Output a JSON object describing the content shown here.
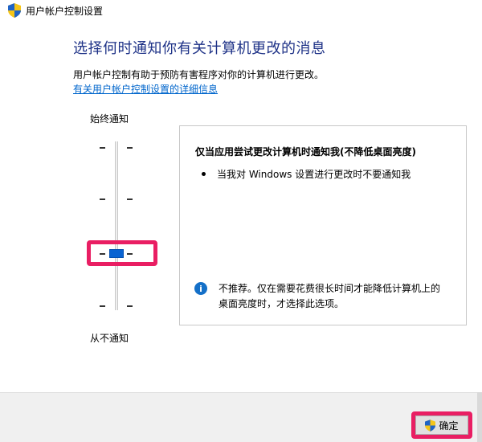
{
  "window": {
    "title": "用户帐户控制设置",
    "icon": "uac-shield-icon"
  },
  "main": {
    "heading": "选择何时通知你有关计算机更改的消息",
    "description": "用户帐户控制有助于预防有害程序对你的计算机进行更改。",
    "more_info_link": "有关用户帐户控制设置的详细信息"
  },
  "slider": {
    "top_label": "始终通知",
    "bottom_label": "从不通知",
    "levels": 4,
    "selected_level": 2,
    "thumb_color": "#0a64d2",
    "highlight_color": "#e91e63"
  },
  "info_panel": {
    "title": "仅当应用尝试更改计算机时通知我(不降低桌面亮度)",
    "bullet": "当我对 Windows 设置进行更改时不要通知我",
    "note_icon": "info-icon",
    "note_line1": "不推荐。仅在需要花费很长时间才能降低计算机上的",
    "note_line2": "桌面亮度时，才选择此选项。"
  },
  "buttons": {
    "ok_label": "确定",
    "ok_icon": "uac-shield-icon"
  }
}
